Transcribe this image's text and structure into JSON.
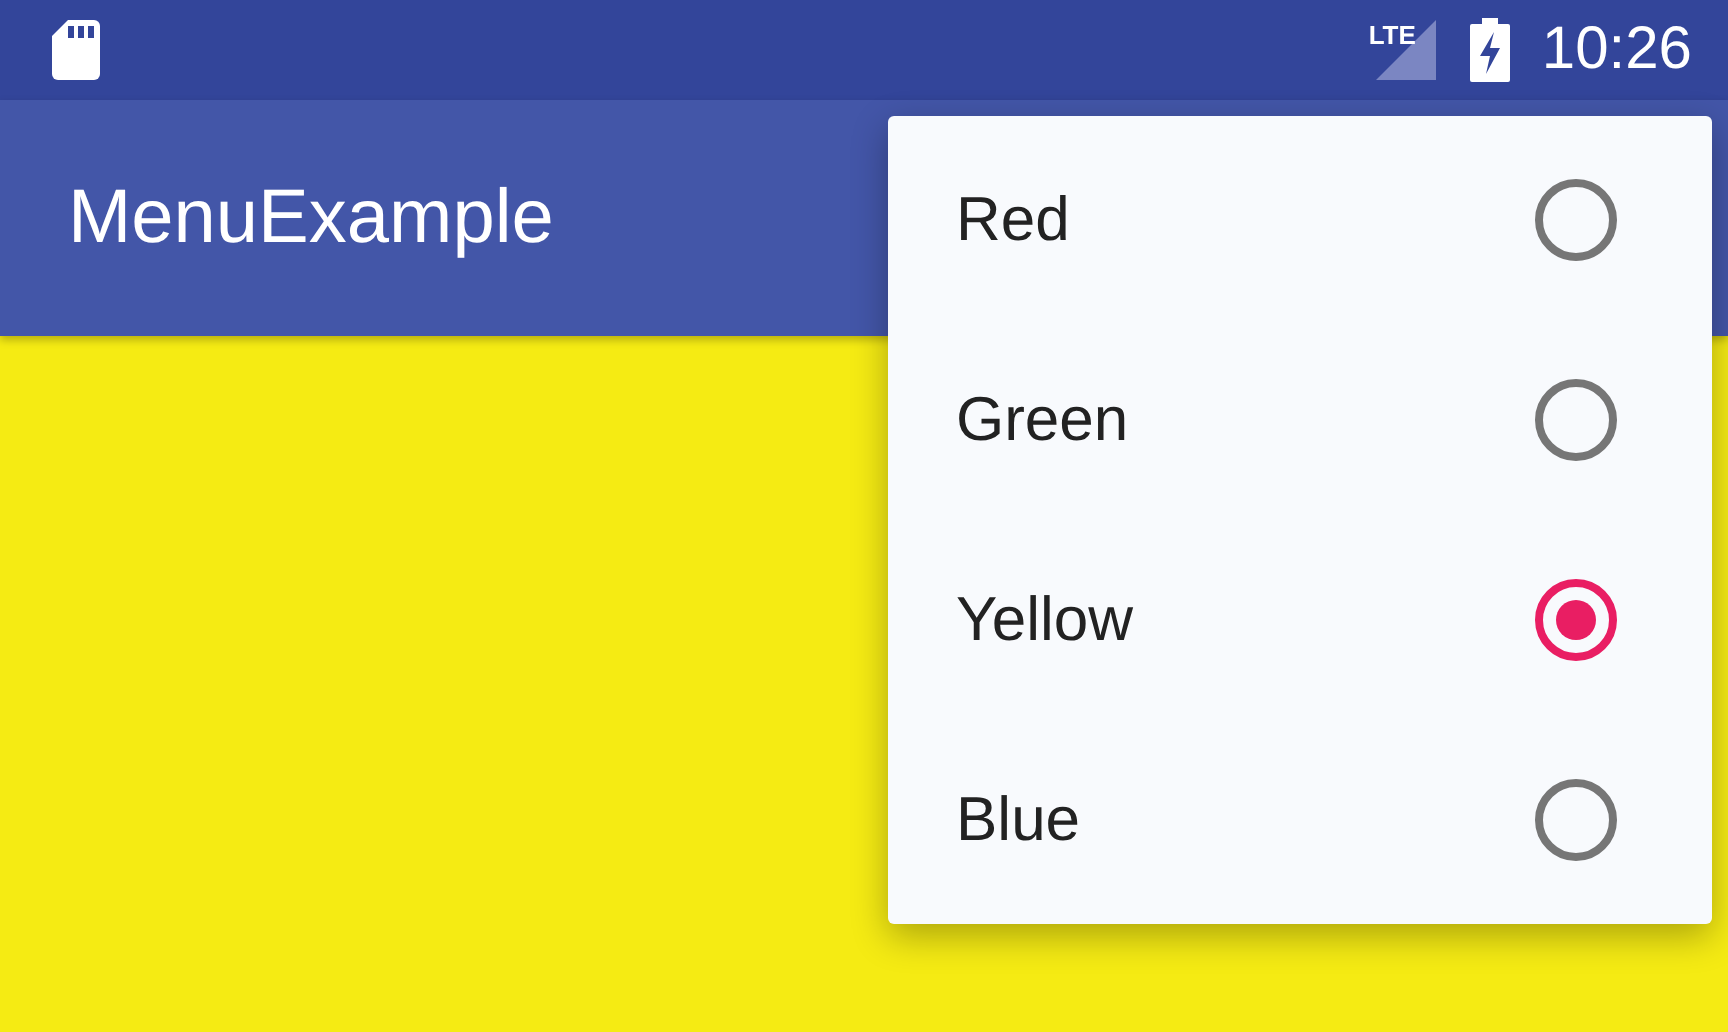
{
  "status_bar": {
    "network": "LTE",
    "time": "10:26"
  },
  "app_bar": {
    "title": "MenuExample"
  },
  "menu": {
    "items": [
      {
        "label": "Red",
        "selected": false
      },
      {
        "label": "Green",
        "selected": false
      },
      {
        "label": "Yellow",
        "selected": true
      },
      {
        "label": "Blue",
        "selected": false
      }
    ]
  }
}
